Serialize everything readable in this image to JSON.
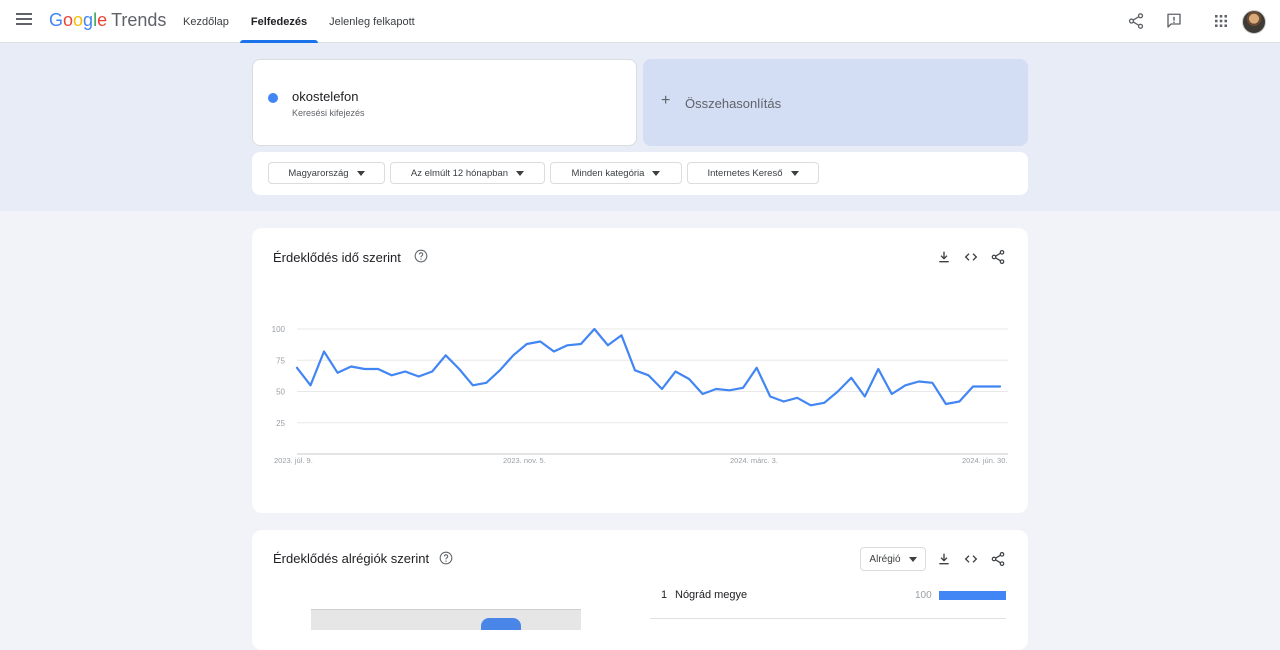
{
  "header": {
    "logo_google": [
      "G",
      "o",
      "o",
      "g",
      "l",
      "e"
    ],
    "logo_trends": "Trends",
    "tabs": [
      {
        "label": "Kezdőlap",
        "active": false
      },
      {
        "label": "Felfedezés",
        "active": true
      },
      {
        "label": "Jelenleg felkapott",
        "active": false
      }
    ]
  },
  "search": {
    "term": "okostelefon",
    "term_type": "Keresési kifejezés",
    "term_color": "#4285f4",
    "compare_label": "Összehasonlítás"
  },
  "filters": [
    {
      "label": "Magyarország"
    },
    {
      "label": "Az elmúlt 12 hónapban"
    },
    {
      "label": "Minden kategória"
    },
    {
      "label": "Internetes Kereső"
    }
  ],
  "interest_over_time": {
    "title": "Érdeklődés idő szerint",
    "chart_data": {
      "type": "line",
      "x_labels": [
        "2023. júl. 9.",
        "2023. nov. 5.",
        "2024. márc. 3.",
        "2024. jún. 30."
      ],
      "y_ticks": [
        25,
        50,
        75,
        100
      ],
      "ylim": [
        0,
        100
      ],
      "grid": true,
      "series": [
        {
          "color": "#4285f4",
          "values": [
            69,
            55,
            82,
            65,
            70,
            68,
            68,
            63,
            66,
            62,
            66,
            79,
            68,
            55,
            57,
            67,
            79,
            88,
            90,
            82,
            87,
            88,
            100,
            87,
            95,
            67,
            63,
            52,
            66,
            60,
            48,
            52,
            51,
            53,
            69,
            46,
            42,
            45,
            39,
            41,
            50,
            61,
            46,
            68,
            48,
            55,
            58,
            57,
            40,
            42,
            54,
            54,
            54
          ]
        }
      ]
    }
  },
  "interest_by_subregion": {
    "title": "Érdeklődés alrégiók szerint",
    "select_value": "Alrégió",
    "rows": [
      {
        "rank": "1",
        "name": "Nógrád megye",
        "value": "100",
        "fraction": 1.0
      }
    ]
  }
}
